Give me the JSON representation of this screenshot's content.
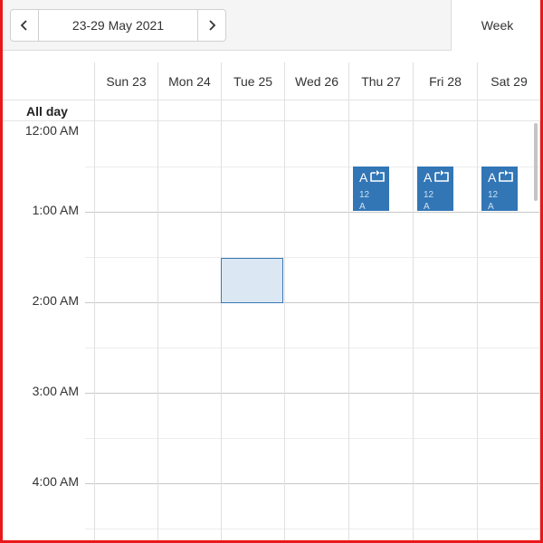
{
  "toolbar": {
    "prev_icon": "chevron-left-icon",
    "next_icon": "chevron-right-icon",
    "date_range": "23-29 May 2021",
    "view_label": "Week"
  },
  "days": [
    {
      "label": "Sun 23"
    },
    {
      "label": "Mon 24"
    },
    {
      "label": "Tue 25"
    },
    {
      "label": "Wed 26"
    },
    {
      "label": "Thu 27"
    },
    {
      "label": "Fri 28"
    },
    {
      "label": "Sat 29"
    }
  ],
  "allday_label": "All day",
  "time_labels": [
    "12:00 AM",
    "1:00 AM",
    "2:00 AM",
    "3:00 AM",
    "4:00 AM"
  ],
  "appointments": [
    {
      "day": "Thu 27",
      "title": "A",
      "time": "12",
      "time2": "A",
      "icon": "recurrence-icon"
    },
    {
      "day": "Fri 28",
      "title": "A",
      "time": "12",
      "time2": "A",
      "icon": "recurrence-icon"
    },
    {
      "day": "Sat 29",
      "title": "A",
      "time": "12",
      "time2": "A",
      "icon": "recurrence-icon"
    }
  ],
  "selection": {
    "day": "Tue 25",
    "slot": "1:30 AM"
  },
  "colors": {
    "appointment": "#3276b6",
    "selected_cell": "#dbe8f4",
    "frame": "#e8191b"
  }
}
